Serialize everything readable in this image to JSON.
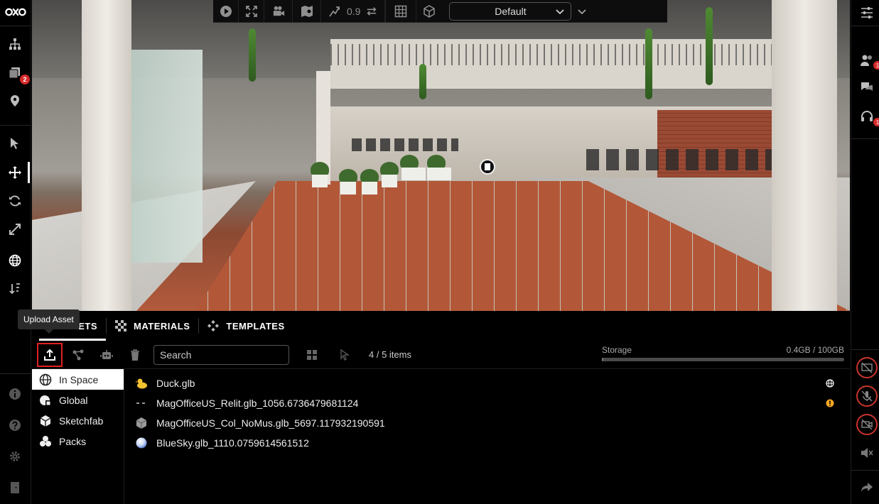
{
  "app": {
    "logo_text": "oko"
  },
  "left_rail": {
    "items": [
      {
        "name": "hierarchy",
        "icon": "hierarchy-icon"
      },
      {
        "name": "library",
        "icon": "layers-icon",
        "badge": "2"
      },
      {
        "name": "location",
        "icon": "location-pin-icon"
      },
      {
        "name": "select",
        "icon": "cursor-arrow-icon"
      },
      {
        "name": "move",
        "icon": "move-arrows-icon",
        "active": true
      },
      {
        "name": "rotate",
        "icon": "rotate-icon"
      },
      {
        "name": "scale",
        "icon": "scale-arrows-icon"
      },
      {
        "name": "world",
        "icon": "globe-icon"
      },
      {
        "name": "sort",
        "icon": "sort-icon"
      },
      {
        "name": "info",
        "icon": "info-icon"
      },
      {
        "name": "help",
        "icon": "help-icon"
      },
      {
        "name": "settings",
        "icon": "gear-icon"
      },
      {
        "name": "exit",
        "icon": "exit-door-icon"
      }
    ]
  },
  "toolbar": {
    "speed_value": "0.9",
    "environment_select": "Default"
  },
  "tabs": [
    {
      "label": "ASSETS",
      "visible_label": "ETS",
      "active": true
    },
    {
      "label": "MATERIALS"
    },
    {
      "label": "TEMPLATES"
    }
  ],
  "tooltip": {
    "text": "Upload Asset"
  },
  "subbar": {
    "search_placeholder": "Search",
    "items_count": "4 / 5 items",
    "storage_label": "Storage",
    "storage_value": "0.4GB / 100GB",
    "storage_fraction": 0.004
  },
  "sidebar": {
    "items": [
      {
        "label": "In Space",
        "icon": "globe-icon",
        "active": true
      },
      {
        "label": "Global",
        "icon": "global-library-icon"
      },
      {
        "label": "Sketchfab",
        "icon": "sketchfab-icon"
      },
      {
        "label": "Packs",
        "icon": "packs-icon"
      }
    ]
  },
  "assets": [
    {
      "name": "Duck.glb",
      "icon": "duck-icon",
      "status": "globe-icon"
    },
    {
      "name": "MagOfficeUS_Relit.glb_1056.6736479681124",
      "icon": "dash-icon",
      "status": "warning-icon"
    },
    {
      "name": "MagOfficeUS_Col_NoMus.glb_5697.117932190591",
      "icon": "cube-icon",
      "status": ""
    },
    {
      "name": "BlueSky.glb_1110.0759614561512",
      "icon": "sphere-icon",
      "status": ""
    }
  ],
  "right_rail": {
    "badges": [
      "1",
      "1"
    ]
  },
  "colors": {
    "accent_red": "#d62b2b",
    "warning": "#f5a623",
    "highlight_border": "#e02020"
  }
}
